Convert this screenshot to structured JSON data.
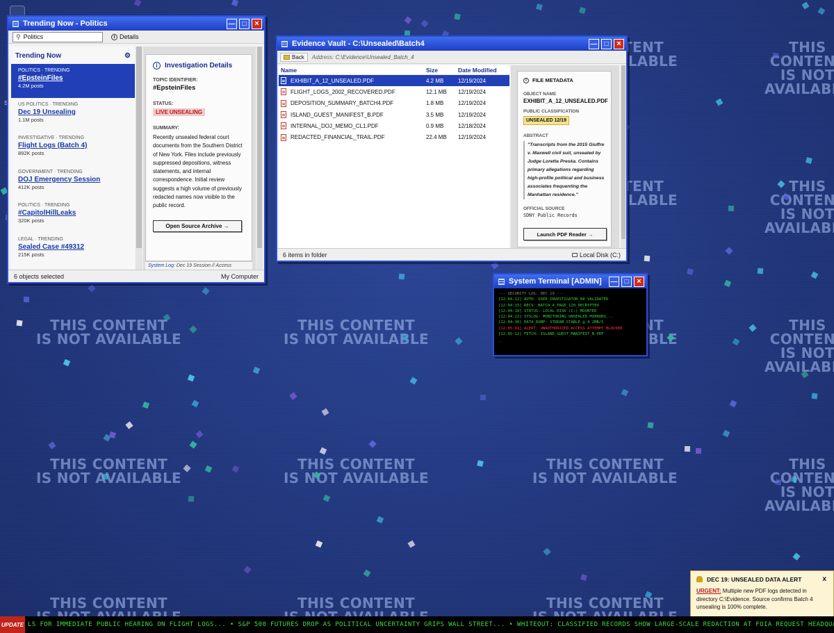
{
  "desktop": {
    "watermark_line1": "THIS CONTENT",
    "watermark_line2": "IS NOT AVAILABLE",
    "stray_letter": "S"
  },
  "trending_window": {
    "title": "Trending Now - Politics",
    "search_value": "Politics",
    "details_label": "Details",
    "list_heading": "Trending Now",
    "items": [
      {
        "category": "POLITICS · TRENDING",
        "title": "#EpsteinFiles",
        "count": "4.2M posts",
        "selected": true
      },
      {
        "category": "US POLITICS · TRENDING",
        "title": "Dec 19 Unsealing",
        "count": "1.1M posts"
      },
      {
        "category": "INVESTIGATIVE · TRENDING",
        "title": "Flight Logs (Batch 4)",
        "count": "892K posts"
      },
      {
        "category": "GOVERNMENT · TRENDING",
        "title": "DOJ Emergency Session",
        "count": "412K posts"
      },
      {
        "category": "POLITICS · TRENDING",
        "title": "#CapitolHillLeaks",
        "count": "320K posts"
      },
      {
        "category": "LEGAL · TRENDING",
        "title": "Sealed Case #49312",
        "count": "215K posts"
      }
    ],
    "details": {
      "heading": "Investigation Details",
      "topic_label": "TOPIC IDENTIFIER:",
      "topic_value": "#EpsteinFiles",
      "status_label": "STATUS:",
      "status_value": "LIVE UNSEALING",
      "summary_label": "SUMMARY:",
      "summary_text": "Recently unsealed federal court documents from the Southern District of New York. Files include previously suppressed depositions, witness statements, and internal correspondence. Initial review suggests a high volume of previously redacted names now visible to the public record.",
      "button_label": "Open Source Archive",
      "syslog_keyword": "System Log",
      "syslog_text": ": Dec 19 Session // Access"
    },
    "status_left": "6 objects selected",
    "status_right": "My Computer"
  },
  "evidence_window": {
    "title": "Evidence Vault - C:\\Unsealed\\Batch4",
    "back_label": "Back",
    "address_label": "Address:",
    "address_value": "C:\\Evidence\\Unsealed_Batch_4",
    "columns": {
      "name": "Name",
      "size": "Size",
      "date": "Date Modified"
    },
    "files": [
      {
        "name": "EXHIBIT_A_12_UNSEALED.PDF",
        "size": "4.2 MB",
        "date": "12/19/2024",
        "selected": true
      },
      {
        "name": "FLIGHT_LOGS_2002_RECOVERED.PDF",
        "size": "12.1 MB",
        "date": "12/19/2024"
      },
      {
        "name": "DEPOSITION_SUMMARY_BATCH4.PDF",
        "size": "1.8 MB",
        "date": "12/19/2024"
      },
      {
        "name": "ISLAND_GUEST_MANIFEST_B.PDF",
        "size": "3.5 MB",
        "date": "12/19/2024"
      },
      {
        "name": "INTERNAL_DOJ_MEMO_CL1.PDF",
        "size": "0.9 MB",
        "date": "12/18/2024"
      },
      {
        "name": "REDACTED_FINANCIAL_TRAIL.PDF",
        "size": "22.4 MB",
        "date": "12/19/2024"
      }
    ],
    "metadata": {
      "heading": "FILE METADATA",
      "object_label": "OBJECT NAME",
      "object_value": "EXHIBIT_A_12_UNSEALED.PDF",
      "class_label": "PUBLIC CLASSIFICATION",
      "class_value": "UNSEALED 12/19",
      "abstract_label": "ABSTRACT",
      "abstract_text": "\"Transcripts from the 2015 Giuffre v. Maxwell civil suit, unsealed by Judge Loretta Preska. Contains primary allegations regarding high-profile political and business associates frequenting the Manhattan residence.\"",
      "source_label": "OFFICIAL SOURCE",
      "source_value": "SDNY Public Records",
      "button_label": "Launch PDF Reader"
    },
    "status_left": "6 items in folder",
    "status_right": "Local Disk (C:)"
  },
  "terminal": {
    "title": "System Terminal [ADMIN]",
    "header": "--- SECURITY LOG: DEC 19 ---",
    "lines": [
      "[12:04:12] AUTH: USER_INVESTIGATOR_88 VALIDATED",
      "[12:04:15] RECV: BATCH_4_PAGE_120_DECRYPTED",
      "[12:04:18] STATUS: LOCAL DISK (C:) MOUNTED",
      "[12:04:22] SYSLOG: MONITORING UNSEALED MIRRORS...",
      "[12:04:30] DATA_DUMP: STREAM STABLE @ 4.2MB/S"
    ],
    "alert_line": "[12:05:01] ALERT: UNAUTHORIZED ACCESS ATTEMPT BLOCKED",
    "last_line": "[12:05:12] FETCH: ISLAND_GUEST_MANIFEST_B.PDF",
    "cursor": "_"
  },
  "notification": {
    "title": "DEC 19: UNSEALED DATA ALERT",
    "close": "x",
    "urgent_label": "URGENT:",
    "body": " Multiple new PDF logs detected in directory C:\\Evidence. Source confirms Batch 4 unsealing is 100% complete."
  },
  "ticker": {
    "label": "UPDATE",
    "text": "LS FOR IMMEDIATE PUBLIC HEARING ON FLIGHT LOGS... • S&P 500 FUTURES DROP AS POLITICAL UNCERTAINTY GRIPS WALL STREET... • WHITEOUT: CLASSIFIED RECORDS SHOW LARGE-SCALE REDACTION AT FOIA REQUEST HEADQUARTERS... • BREAKING: UNSEALED C"
  },
  "colors": {
    "desktop": "#21387e",
    "titlebar": "#2a4fd8",
    "selection": "#2140b8",
    "alert_red": "#b31b1b",
    "terminal_green": "#36d23a"
  }
}
